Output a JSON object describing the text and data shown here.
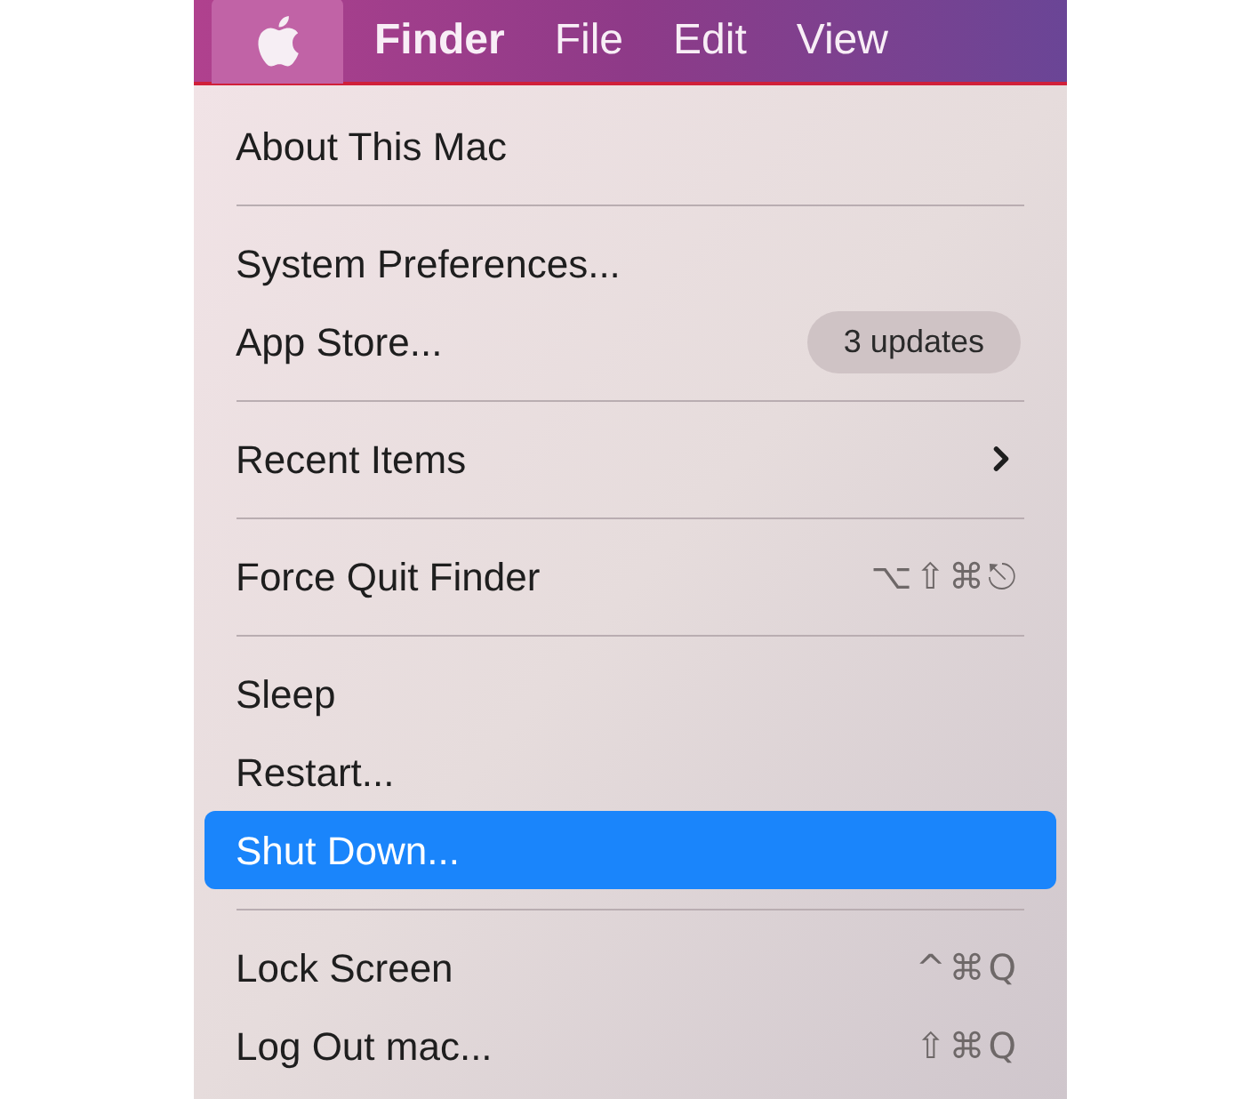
{
  "menubar": [
    {
      "kind": "apple",
      "selected": true
    },
    {
      "kind": "text",
      "label": "Finder",
      "bold": true,
      "selected": false
    },
    {
      "kind": "text",
      "label": "File",
      "bold": false,
      "selected": false
    },
    {
      "kind": "text",
      "label": "Edit",
      "bold": false,
      "selected": false
    },
    {
      "kind": "text",
      "label": "View",
      "bold": false,
      "selected": false
    }
  ],
  "menu": [
    {
      "kind": "item",
      "label": "About This Mac",
      "selected": false
    },
    {
      "kind": "separator"
    },
    {
      "kind": "item",
      "label": "System Preferences...",
      "selected": false
    },
    {
      "kind": "item",
      "label": "App Store...",
      "badge": "3 updates",
      "selected": false
    },
    {
      "kind": "separator"
    },
    {
      "kind": "item",
      "label": "Recent Items",
      "submenu": true,
      "selected": false
    },
    {
      "kind": "separator"
    },
    {
      "kind": "item",
      "label": "Force Quit Finder",
      "shortcut": "⌥⇧⌘⎋",
      "selected": false
    },
    {
      "kind": "separator"
    },
    {
      "kind": "item",
      "label": "Sleep",
      "selected": false
    },
    {
      "kind": "item",
      "label": "Restart...",
      "selected": false
    },
    {
      "kind": "item",
      "label": "Shut Down...",
      "selected": true
    },
    {
      "kind": "separator"
    },
    {
      "kind": "item",
      "label": "Lock Screen",
      "shortcut": "^⌘Q",
      "selected": false
    },
    {
      "kind": "item",
      "label": "Log Out mac...",
      "shortcut": "⇧⌘Q",
      "selected": false
    }
  ]
}
